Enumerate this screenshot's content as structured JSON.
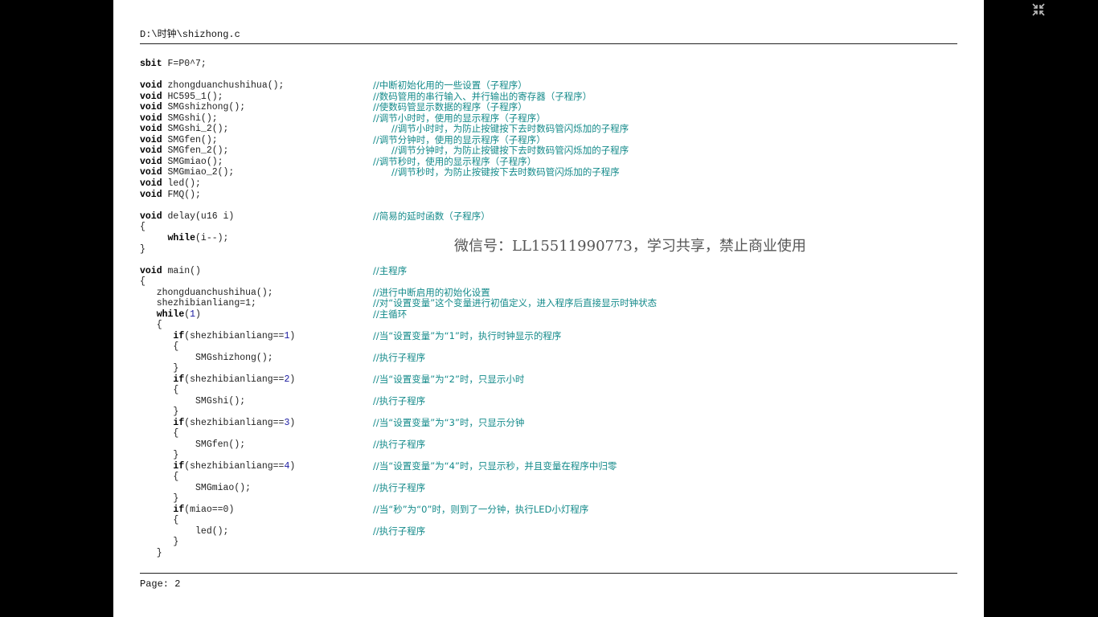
{
  "document": {
    "header_path": "D:\\时钟\\shizhong.c",
    "footer_page": "Page: 2",
    "watermark": "微信号：LL15511990773，学习共享，禁止商业使用"
  },
  "icons": {
    "exit_fullscreen": "exit-fullscreen-icon"
  },
  "lines": [
    {
      "kw": "sbit",
      "rest": " F=P0^7;"
    },
    {
      "kw": "void",
      "rest": " zhongduanchushihua();",
      "comment": "//中断初始化用的一些设置（子程序）"
    },
    {
      "kw": "void",
      "rest": " HC595_1();",
      "comment": "//数码管用的串行输入、并行输出的寄存器（子程序）"
    },
    {
      "kw": "void",
      "rest": " SMGshizhong();",
      "comment": "//使数码管显示数据的程序（子程序）"
    },
    {
      "kw": "void",
      "rest": " SMGshi();",
      "comment": "//调节小时时，使用的显示程序（子程序）"
    },
    {
      "kw": "void",
      "rest": " SMGshi_2();",
      "comment": "//调节小时时，为防止按键按下去时数码管闪烁加的子程序"
    },
    {
      "kw": "void",
      "rest": " SMGfen();",
      "comment": "//调节分钟时，使用的显示程序（子程序）"
    },
    {
      "kw": "void",
      "rest": " SMGfen_2();",
      "comment": "//调节分钟时，为防止按键按下去时数码管闪烁加的子程序"
    },
    {
      "kw": "void",
      "rest": " SMGmiao();",
      "comment": "//调节秒时，使用的显示程序（子程序）"
    },
    {
      "kw": "void",
      "rest": " SMGmiao_2();",
      "comment": "//调节秒时，为防止按键按下去时数码管闪烁加的子程序"
    },
    {
      "kw": "void",
      "rest": " led();"
    },
    {
      "kw": "void",
      "rest": " FMQ();"
    },
    {
      "kw": "void",
      "rest": " delay(u16 i)",
      "comment": "//简易的延时函数（子程序）"
    },
    {
      "rest": "{"
    },
    {
      "prefix": "     ",
      "kw": "while",
      "rest": "(i--);"
    },
    {
      "rest": "}"
    },
    {
      "kw": "void",
      "rest": " main()",
      "comment": "//主程序"
    },
    {
      "rest": "{"
    },
    {
      "rest": "   zhongduanchushihua();",
      "comment": "//进行中断启用的初始化设置"
    },
    {
      "rest": "   shezhibianliang=1;",
      "comment": "//对“设置变量”这个变量进行初值定义，进入程序后直接显示时钟状态"
    },
    {
      "prefix": "   ",
      "kw": "while",
      "rest": "(",
      "num": "1",
      "tail": ")",
      "comment": "//主循环"
    },
    {
      "rest": "   {"
    },
    {
      "prefix": "      ",
      "kw": "if",
      "rest": "(shezhibianliang==",
      "num": "1",
      "tail": ")",
      "comment": "//当“设置变量”为“1”时，执行时钟显示的程序"
    },
    {
      "rest": "      {"
    },
    {
      "rest": "          SMGshizhong();",
      "comment": "//执行子程序"
    },
    {
      "rest": "      }"
    },
    {
      "prefix": "      ",
      "kw": "if",
      "rest": "(shezhibianliang==",
      "num": "2",
      "tail": ")",
      "comment": "//当“设置变量”为“2”时，只显示小时"
    },
    {
      "rest": "      {"
    },
    {
      "rest": "          SMGshi();",
      "comment": "//执行子程序"
    },
    {
      "rest": "      }"
    },
    {
      "prefix": "      ",
      "kw": "if",
      "rest": "(shezhibianliang==",
      "num": "3",
      "tail": ")",
      "comment": "//当“设置变量”为“3”时，只显示分钟"
    },
    {
      "rest": "      {"
    },
    {
      "rest": "          SMGfen();",
      "comment": "//执行子程序"
    },
    {
      "rest": "      }"
    },
    {
      "prefix": "      ",
      "kw": "if",
      "rest": "(shezhibianliang==",
      "num": "4",
      "tail": ")",
      "comment": "//当“设置变量”为“4”时，只显示秒，并且变量在程序中归零"
    },
    {
      "rest": "      {"
    },
    {
      "rest": "          SMGmiao();",
      "comment": "//执行子程序"
    },
    {
      "rest": "      }"
    },
    {
      "prefix": "      ",
      "kw": "if",
      "rest": "(miao==0)",
      "comment": "//当“秒”为“0”时，则到了一分钟，执行LED小灯程序"
    },
    {
      "rest": "      {"
    },
    {
      "rest": "          led();",
      "comment": "//执行子程序"
    },
    {
      "rest": "      }"
    },
    {
      "rest": "   }"
    }
  ]
}
